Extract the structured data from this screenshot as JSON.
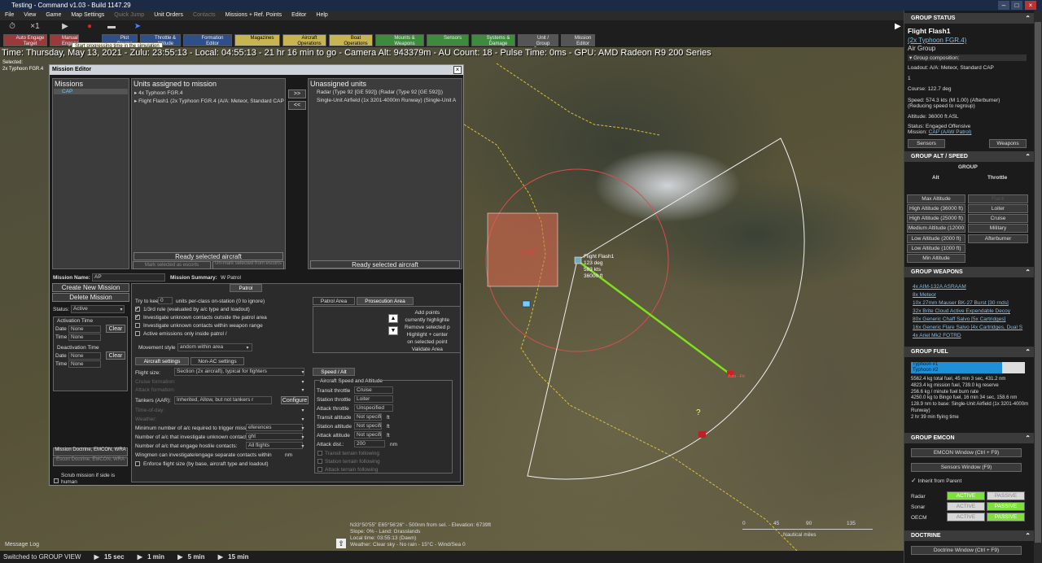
{
  "window": {
    "title": "Testing - Command v1.03 - Build 1147.29"
  },
  "menu": [
    "File",
    "View",
    "Game",
    "Map Settings",
    "Quick Jump",
    "Unit Orders",
    "Contacts",
    "Missions + Ref. Points",
    "Editor",
    "Help"
  ],
  "toolbar": {
    "speed": "×1",
    "tooltip": "Start progressing time in the simulation",
    "order_buttons": [
      "Auto Engage Target",
      "Manual Engage",
      "Plot Course",
      "Throttle & Altitude",
      "Formation Editor",
      "Magazines",
      "Aircraft Operations",
      "Boat Operations",
      "Mounts & Weapons",
      "Sensors",
      "Systems & Damage",
      "Unit / Group Doctrine",
      "Mission Editor"
    ]
  },
  "status_line": "Time: Thursday, May 13, 2021 - Zulu: 23:55:13 - Local: 04:55:13 - 21 hr 16 min to go -  Camera Alt: 943379m  - AU Count: 18 - Pulse Time: 0ms - GPU: AMD Radeon R9 200 Series",
  "selected": {
    "label": "Selected:",
    "unit": "2x Typhoon FGR.4"
  },
  "map": {
    "area_label": "CAP",
    "unit": {
      "name": "Flight Flash1",
      "course": "123 deg",
      "speed": "583 kts",
      "alt": "36000 ft"
    },
    "target_label": "Auto - Fri",
    "unknown": "?",
    "coord_lines": [
      "N33°50'55\"   E65°56'26\"   - 500nm from sel. - Elevation: 6739ft",
      "Slope: 0%  - Land: Grasslands",
      "Local time: 03:55:13 (Dawn)",
      "Weather: Clear sky - No rain  - 15°C - Wind/Sea 0"
    ],
    "scale": {
      "ticks": [
        "0",
        "45",
        "90",
        "135"
      ],
      "unit": "Nautical miles"
    }
  },
  "nav": {
    "status": "Switched to GROUP VIEW",
    "compressions": [
      "15 sec",
      "1 min",
      "5 min",
      "15 min"
    ],
    "message_log": "Message Log"
  },
  "mission_editor": {
    "title": "Mission Editor",
    "missions": {
      "header": "Missions",
      "items": [
        "CAP"
      ]
    },
    "assigned": {
      "header": "Units assigned to mission",
      "items": [
        "4x Typhoon FGR.4",
        "Flight Flash1 (2x Typhoon FGR.4 (A/A: Meteor, Standard CAP"
      ],
      "ready": "Ready selected aircraft",
      "escort": "Mark selected as escorts",
      "unmark": "Un-mark selected from escorts"
    },
    "unassigned": {
      "header": "Unassigned units",
      "items": [
        "Radar (Type 92 [GE 592]) (Radar (Type 92 [GE 592]))",
        "Single-Unit Airfield (1x 3201-4000m Runway) (Single-Unit A"
      ],
      "ready": "Ready selected aircraft"
    },
    "move_right": ">>",
    "move_left": "<<",
    "name_label": "Mission Name:",
    "name_value": "AP",
    "summary_label": "Mission Summary:",
    "summary_value": "W Patrol",
    "create": "Create New Mission",
    "delete": "Delete Mission",
    "status_label": "Status:",
    "status_value": "Active",
    "activation": {
      "title": "Activation Time",
      "date": "Date",
      "time": "Time",
      "date_val": "None",
      "time_val": "None",
      "clear": "Clear"
    },
    "deactivation": {
      "title": "Deactivation Time",
      "date": "Date",
      "time": "Time",
      "date_val": "None",
      "time_val": "None",
      "clear": "Clear"
    },
    "doctrine_btn": "Mission Doctrine, EMCON, WRA",
    "escort_btn": "Escort Doctrine, EMCON, WRA",
    "scrub": "Scrub mission if side is human",
    "patrol_tab": "Patrol",
    "try_keep": "Try to keep",
    "try_keep_val": "0",
    "try_keep_suffix": "units per-class on-station (0 to ignore)",
    "rules": [
      "1/3rd rule (evaluated by a/c type and loadout)",
      "Investigate unknown contacts outside the patrol area",
      "Investigate unknown contacts within weapon range",
      "Active emissions only inside patrol /"
    ],
    "movement_label": "Movement style",
    "movement_val": "andom within area",
    "area_tabs": [
      "Patrol Area",
      "Prosecution Area"
    ],
    "area_buttons": [
      "Add points",
      "currently highlighte",
      "Remove  selected p",
      "Highlight + center",
      "on selected point",
      "Validate Area"
    ],
    "aircraft_tabs": [
      "Aircraft settings",
      "Non-AC settings"
    ],
    "flight_size_label": "Flight size:",
    "flight_size_val": "Section (2x aircraft), typical for fighters",
    "dim_fields": [
      "Cruise formation:",
      "Attack formation:",
      "Time-of-day:",
      "Weather:"
    ],
    "tankers_label": "Tankers (AAR):",
    "tankers_val": "Inherited, Allow, but not tankers r",
    "configure": "Configure",
    "min_label": "Minimum number of a/c required to trigger mission:",
    "min_val": "eferences",
    "inv_label": "Number of a/c that investigate unknown contacts:",
    "inv_val": "ght",
    "eng_label": "Number of a/c that engage hostile contacts:",
    "eng_val": "All flights",
    "wingmen": "Wingmen can investigate/engage separate contacts within",
    "wingmen_unit": "nm",
    "enforce": "Enforce flight size (by base, aircraft type and loadout)",
    "speed_tab": "Speed / Alt",
    "speed_group": "Aircraft Speed and Altitude",
    "speed_rows": [
      {
        "label": "Transit throttle",
        "val": "Cruise"
      },
      {
        "label": "Station throttle",
        "val": "Loiter"
      },
      {
        "label": "Attack throttle",
        "val": "Unspecified"
      },
      {
        "label": "Transit altitude",
        "val": "Not specified",
        "unit": "ft"
      },
      {
        "label": "Station altitude",
        "val": "Not specified",
        "unit": "ft"
      },
      {
        "label": "Attack altitude",
        "val": "Not specified",
        "unit": "ft"
      },
      {
        "label": "Attack dist.:",
        "val": "200",
        "unit": "nm"
      }
    ],
    "terrain": [
      "Transit terrain following",
      "Station terrain following",
      "Attack terrain following"
    ]
  },
  "right_panel": {
    "group_status": {
      "header": "GROUP STATUS",
      "name": "Flight Flash1",
      "link": "(2x Typhoon FGR.4)",
      "type": "Air Group",
      "composition": "Group composition:",
      "loadout": "Loadout: A/A: Meteor, Standard CAP",
      "count": "1",
      "course": "Course: 122.7 deg",
      "speed1": "Speed: 574.3 kts (M 1.00) (Afterburner)",
      "speed2": "(Reducing speed to regroup)",
      "altitude": "Altitude: 36000 ft ASL",
      "status": "Status: Engaged Offensive",
      "mission_label": "Mission:",
      "mission_link": "CAP (AAW Patrol)",
      "sensors": "Sensors",
      "weapons": "Weapons"
    },
    "group_alt": {
      "header": "GROUP ALT / SPEED",
      "group": "GROUP",
      "alt": "Alt",
      "throttle": "Throttle",
      "alt_buttons": [
        "Max Altitude",
        "High Altitude (36000 ft)",
        "High Altitude (25000 ft)",
        "Medium Altitude (12000",
        "Low Altitude (2000 ft)",
        "Low Altitude (1000 ft)",
        "Min Altitude"
      ],
      "throttle_buttons": [
        "Flank",
        "Loiter",
        "Cruise",
        "Military",
        "Afterburner"
      ]
    },
    "group_weapons": {
      "header": "GROUP WEAPONS",
      "items": [
        "4x AIM-132A ASRAAM",
        "8x Meteor",
        "10x 27mm Mauser BK-27 Burst [30 rnds]",
        "32x Brite Cloud Active Expendable Decoy",
        "80x Generic Chaff Salvo [5x Cartridges]",
        "16x Generic Flare Salvo [4x Cartridges, Dual S",
        "4x Ariel Mk2 FOTRD"
      ]
    },
    "group_fuel": {
      "header": "GROUP FUEL",
      "bars": [
        {
          "name": "Typhoon #1",
          "fraction": 0.8
        },
        {
          "name": "Typhoon #2",
          "fraction": 0.8
        }
      ],
      "lines": [
        "5562.4 kg total fuel, 45 min 3 sec, 431.2 nm",
        "4823.4 kg mission fuel, 739.0 kg reserve",
        "256.6 kg / minute fuel burn rate",
        "4250.0 kg to Bingo fuel, 16 min 34 sec, 158.6 nm",
        "128.9 nm to base: Single-Unit Airfield (1x 3201-4000m Runway)",
        "2 hr 39 min flying time"
      ]
    },
    "group_emcon": {
      "header": "GROUP EMCON",
      "emcon_btn": "EMCON Window (Ctrl + F9)",
      "sensors_btn": "Sensors Window (F9)",
      "inherit": "Inherit from Parent",
      "rows": [
        {
          "label": "Radar",
          "a": "ACTIVE",
          "p": "PASSIVE"
        },
        {
          "label": "Sonar",
          "a": "ACTIVE",
          "p": "PASSIVE"
        },
        {
          "label": "OECM",
          "a": "ACTIVE",
          "p": "PASSIVE"
        }
      ]
    },
    "doctrine": {
      "header": "DOCTRINE",
      "btn": "Doctrine Window (Ctrl + F9)"
    }
  }
}
